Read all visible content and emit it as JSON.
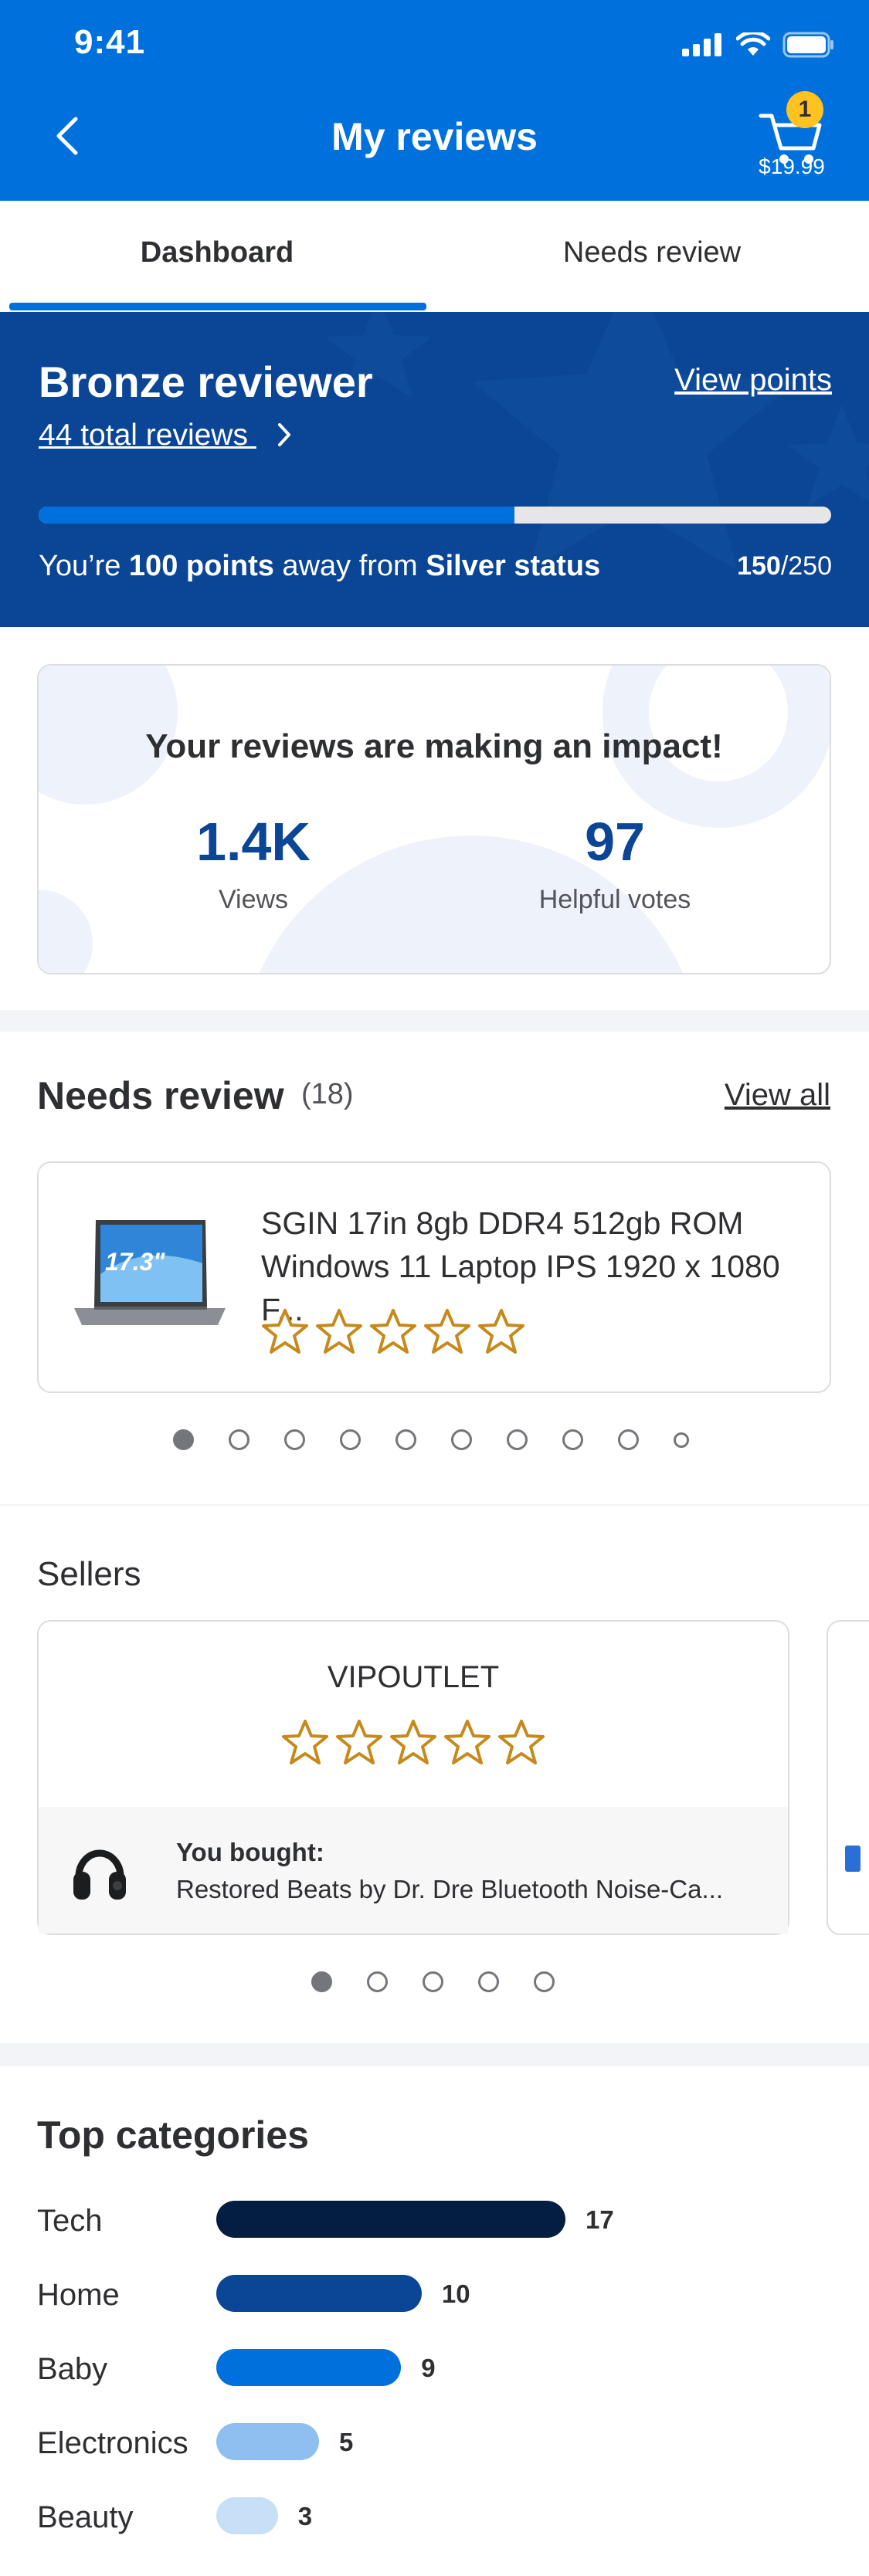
{
  "status_bar": {
    "time": "9:41"
  },
  "nav": {
    "title": "My reviews",
    "cart_count": "1",
    "cart_total": "$19.99"
  },
  "tabs": [
    {
      "label": "Dashboard",
      "active": true
    },
    {
      "label": "Needs review",
      "active": false
    }
  ],
  "reviewer": {
    "level": "Bronze reviewer",
    "view_points": "View points",
    "total_reviews": "44 total reviews",
    "progress_fraction": 0.6,
    "msg_prefix": "You’re ",
    "msg_points": "100 points",
    "msg_middle": " away from ",
    "msg_status": "Silver status",
    "points_current": "150",
    "points_total": "/250"
  },
  "impact": {
    "title": "Your reviews are making an impact!",
    "views_value": "1.4K",
    "views_label": "Views",
    "votes_value": "97",
    "votes_label": "Helpful votes"
  },
  "needs_review": {
    "title": "Needs review",
    "count": "(18)",
    "view_all": "View all",
    "product_name": "SGIN 17in 8gb DDR4 512gb ROM Windows 11 Laptop IPS 1920 x 1080 F...",
    "laptop_badge": "17.3\"",
    "stars": 5,
    "carousel_pages": 10,
    "carousel_active": 0
  },
  "sellers": {
    "title": "Sellers",
    "seller_name": "VIPOUTLET",
    "bought_label": "You bought:",
    "bought_item": "Restored Beats by Dr. Dre Bluetooth Noise-Ca...",
    "carousel_pages": 5,
    "carousel_active": 0
  },
  "categories": {
    "title": "Top categories",
    "items": [
      {
        "label": "Tech",
        "value": 17,
        "color": "#041e42"
      },
      {
        "label": "Home",
        "value": 10,
        "color": "#0b4595"
      },
      {
        "label": "Baby",
        "value": 9,
        "color": "#0071dc"
      },
      {
        "label": "Electronics",
        "value": 5,
        "color": "#8fbff1"
      },
      {
        "label": "Beauty",
        "value": 3,
        "color": "#c8dff8"
      }
    ]
  },
  "colors": {
    "primary": "#0071dc",
    "navy": "#0b4595",
    "star": "#c6891a",
    "badge": "#ffc220"
  },
  "icons": [
    "back-arrow-icon",
    "cart-icon",
    "chevron-right-icon",
    "star-outline-icon",
    "laptop-image",
    "headphones-image",
    "signal-icon",
    "wifi-icon",
    "battery-icon"
  ]
}
